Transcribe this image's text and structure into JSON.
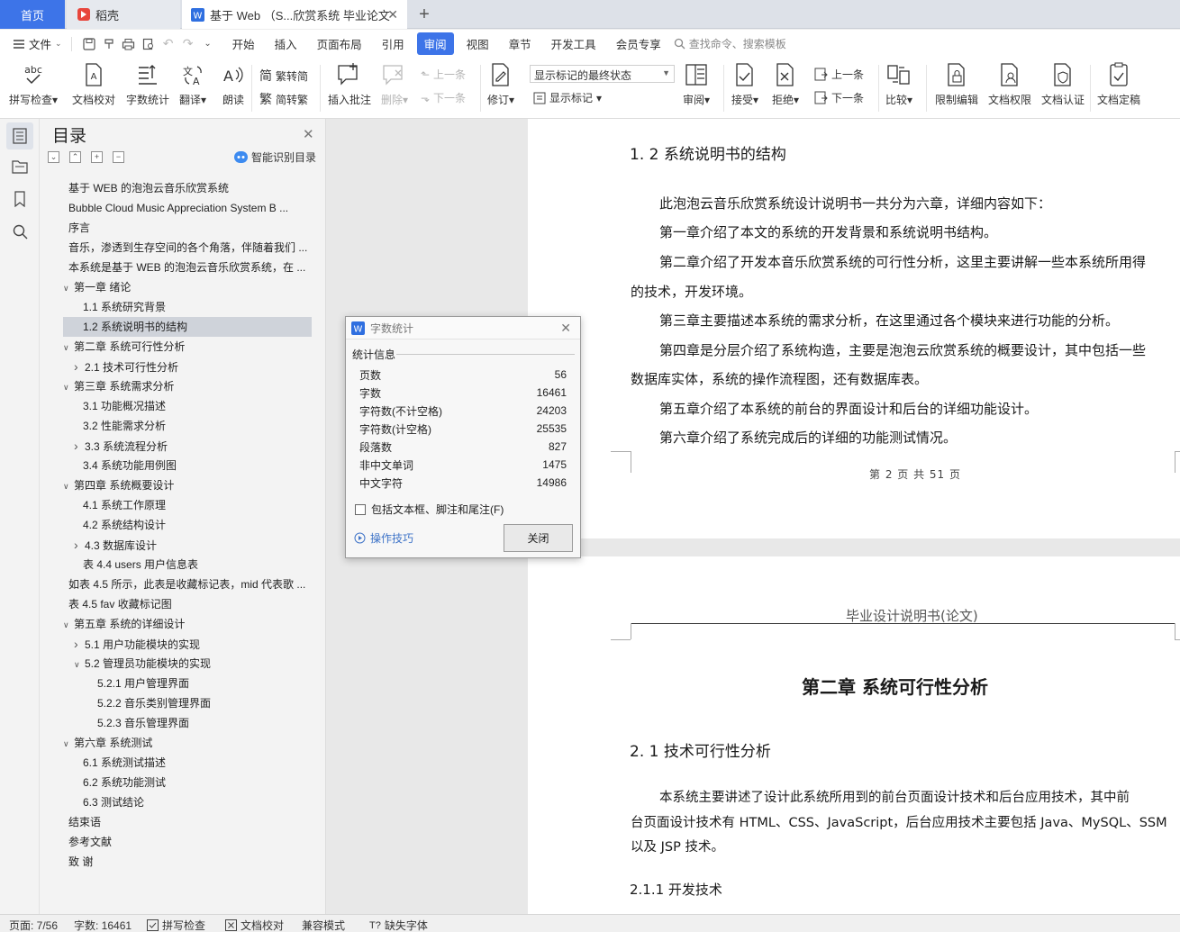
{
  "tabs": {
    "home": "首页",
    "daoke": "稻壳",
    "document": "基于 Web （S...欣赏系统 毕业论文"
  },
  "menu": {
    "file": "文件",
    "items": [
      "开始",
      "插入",
      "页面布局",
      "引用",
      "审阅",
      "视图",
      "章节",
      "开发工具",
      "会员专享"
    ],
    "active": "审阅",
    "search_placeholder": "查找命令、搜索模板"
  },
  "ribbon": {
    "spellcheck": "拼写检查",
    "doc_proof": "文档校对",
    "word_count": "字数统计",
    "translate": "翻译",
    "read_aloud": "朗读",
    "trad_to_simp": "繁转简",
    "simp_to_trad": "简转繁",
    "insert_comment": "插入批注",
    "delete": "删除",
    "prev_comment": "上一条",
    "next_comment": "下一条",
    "revise": "修订",
    "markup_select": "显示标记的最终状态",
    "show_markup": "显示标记",
    "review": "审阅",
    "accept": "接受",
    "reject": "拒绝",
    "prev_change": "上一条",
    "next_change": "下一条",
    "compare": "比较",
    "restrict_edit": "限制编辑",
    "doc_permission": "文档权限",
    "doc_certify": "文档认证",
    "doc_finalize": "文档定稿"
  },
  "toc": {
    "title": "目录",
    "smart_label": "智能识别目录",
    "items": [
      {
        "text": "基于 WEB 的泡泡云音乐欣赏系统",
        "level": 0,
        "chevron": ""
      },
      {
        "text": "Bubble Cloud Music Appreciation System B ...",
        "level": 0,
        "chevron": ""
      },
      {
        "text": "序言",
        "level": 0,
        "chevron": ""
      },
      {
        "text": "音乐，渗透到生存空间的各个角落，伴随着我们 ...",
        "level": 0,
        "chevron": ""
      },
      {
        "text": "本系统是基于 WEB 的泡泡云音乐欣赏系统，在 ...",
        "level": 0,
        "chevron": ""
      },
      {
        "text": "第一章  绪论",
        "level": 0,
        "chevron": "down"
      },
      {
        "text": "1.1  系统研究背景",
        "level": 1,
        "chevron": ""
      },
      {
        "text": "1.2  系统说明书的结构",
        "level": 1,
        "chevron": "",
        "selected": true
      },
      {
        "text": "第二章  系统可行性分析",
        "level": 0,
        "chevron": "down"
      },
      {
        "text": "2.1  技术可行性分析",
        "level": 1,
        "chevron": "right"
      },
      {
        "text": "第三章  系统需求分析",
        "level": 0,
        "chevron": "down"
      },
      {
        "text": "3.1  功能概况描述",
        "level": 1,
        "chevron": ""
      },
      {
        "text": "3.2 性能需求分析",
        "level": 1,
        "chevron": ""
      },
      {
        "text": "3.3 系统流程分析",
        "level": 1,
        "chevron": "right"
      },
      {
        "text": "3.4 系统功能用例图",
        "level": 1,
        "chevron": ""
      },
      {
        "text": "第四章  系统概要设计",
        "level": 0,
        "chevron": "down"
      },
      {
        "text": "4.1 系统工作原理",
        "level": 1,
        "chevron": ""
      },
      {
        "text": "4.2  系统结构设计",
        "level": 1,
        "chevron": ""
      },
      {
        "text": "4.3  数据库设计",
        "level": 1,
        "chevron": "right"
      },
      {
        "text": "表 4.4 users 用户信息表",
        "level": 1,
        "chevron": ""
      },
      {
        "text": "如表 4.5 所示，此表是收藏标记表，mid 代表歌 ...",
        "level": 0,
        "chevron": ""
      },
      {
        "text": "表 4.5 fav 收藏标记图",
        "level": 0,
        "chevron": ""
      },
      {
        "text": "第五章  系统的详细设计",
        "level": 0,
        "chevron": "down"
      },
      {
        "text": "5.1  用户功能模块的实现",
        "level": 1,
        "chevron": "right"
      },
      {
        "text": "5.2  管理员功能模块的实现",
        "level": 1,
        "chevron": "down"
      },
      {
        "text": "5.2.1 用户管理界面",
        "level": 2,
        "chevron": ""
      },
      {
        "text": "5.2.2 音乐类别管理界面",
        "level": 2,
        "chevron": ""
      },
      {
        "text": "5.2.3 音乐管理界面",
        "level": 2,
        "chevron": ""
      },
      {
        "text": "第六章    系统测试",
        "level": 0,
        "chevron": "down"
      },
      {
        "text": "6.1 系统测试描述",
        "level": 1,
        "chevron": ""
      },
      {
        "text": "6.2 系统功能测试",
        "level": 1,
        "chevron": ""
      },
      {
        "text": "6.3 测试结论",
        "level": 1,
        "chevron": ""
      },
      {
        "text": "结束语",
        "level": 0,
        "chevron": ""
      },
      {
        "text": "参考文献",
        "level": 0,
        "chevron": ""
      },
      {
        "text": "致    谢",
        "level": 0,
        "chevron": ""
      }
    ]
  },
  "document": {
    "section_1_2": "1. 2  系统说明书的结构",
    "lines_p1": [
      "此泡泡云音乐欣赏系统设计说明书一共分为六章，详细内容如下：",
      "第一章介绍了本文的系统的开发背景和系统说明书结构。",
      "第二章介绍了开发本音乐欣赏系统的可行性分析，这里主要讲解一些本系统所用得",
      "的技术，开发环境。",
      "第三章主要描述本系统的需求分析，在这里通过各个模块来进行功能的分析。",
      "第四章是分层介绍了系统构造，主要是泡泡云欣赏系统的概要设计，其中包括一些",
      "数据库实体，系统的操作流程图，还有数据库表。",
      "第五章介绍了本系统的前台的界面设计和后台的详细功能设计。",
      "第六章介绍了系统完成后的详细的功能测试情况。"
    ],
    "page_footer": "第 2 页 共 51 页",
    "header2": "毕业设计说明书(论文)",
    "chapter2": "第二章  系统可行性分析",
    "section_2_1": "2. 1  技术可行性分析",
    "lines_p2": [
      "本系统主要讲述了设计此系统所用到的前台页面设计技术和后台应用技术，其中前",
      "台页面设计技术有 HTML、CSS、JavaScript，后台应用技术主要包括 Java、MySQL、SSM",
      "以及 JSP 技术。"
    ],
    "section_2_1_1": "2.1.1  开发技术"
  },
  "dialog": {
    "title": "字数统计",
    "section": "统计信息",
    "stats": [
      {
        "label": "页数",
        "value": "56"
      },
      {
        "label": "字数",
        "value": "16461"
      },
      {
        "label": "字符数(不计空格)",
        "value": "24203"
      },
      {
        "label": "字符数(计空格)",
        "value": "25535"
      },
      {
        "label": "段落数",
        "value": "827"
      },
      {
        "label": "非中文单词",
        "value": "1475"
      },
      {
        "label": "中文字符",
        "value": "14986"
      }
    ],
    "include_label": "包括文本框、脚注和尾注(F)",
    "tips": "操作技巧",
    "close_button": "关闭"
  },
  "status": {
    "page": "页面: 7/56",
    "words": "字数: 16461",
    "spellcheck": "拼写检查",
    "proof": "文档校对",
    "compat": "兼容模式",
    "missing_font": "缺失字体"
  },
  "colors": {
    "accent": "#3d74e8",
    "link": "#3f74c8"
  }
}
